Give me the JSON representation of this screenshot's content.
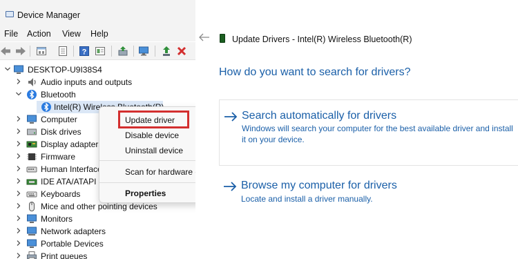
{
  "device_manager": {
    "title": "Device Manager",
    "menu": [
      "File",
      "Action",
      "View",
      "Help"
    ],
    "toolbar_icons": [
      "back-icon",
      "forward-icon",
      "properties-icon",
      "show-hidden-icon",
      "help-icon",
      "action-icon",
      "update-driver-icon",
      "monitor-icon",
      "enable-icon",
      "uninstall-icon"
    ],
    "root": "DESKTOP-U9I38S4",
    "tree": [
      {
        "label": "Audio inputs and outputs",
        "icon": "audio-icon"
      },
      {
        "label": "Bluetooth",
        "icon": "bluetooth-icon",
        "expanded": true
      },
      {
        "label": "Intel(R) Wireless Bluetooth(R)",
        "icon": "bluetooth-device-icon",
        "selected": true
      },
      {
        "label": "Computer",
        "icon": "computer-icon"
      },
      {
        "label": "Disk drives",
        "icon": "disk-drive-icon"
      },
      {
        "label": "Display adapters",
        "icon": "display-adapter-icon"
      },
      {
        "label": "Firmware",
        "icon": "firmware-icon"
      },
      {
        "label": "Human Interface Devices",
        "icon": "hid-icon"
      },
      {
        "label": "IDE ATA/ATAPI controllers",
        "icon": "ide-icon"
      },
      {
        "label": "Keyboards",
        "icon": "keyboard-icon"
      },
      {
        "label": "Mice and other pointing devices",
        "icon": "mouse-icon"
      },
      {
        "label": "Monitors",
        "icon": "monitor-icon"
      },
      {
        "label": "Network adapters",
        "icon": "network-adapter-icon"
      },
      {
        "label": "Portable Devices",
        "icon": "portable-device-icon"
      },
      {
        "label": "Print queues",
        "icon": "printer-icon"
      }
    ]
  },
  "context_menu": {
    "update_driver": "Update driver",
    "disable_device": "Disable device",
    "uninstall_device": "Uninstall device",
    "scan": "Scan for hardware changes",
    "properties": "Properties"
  },
  "update_drivers": {
    "title": "Update Drivers - Intel(R) Wireless Bluetooth(R)",
    "heading": "How do you want to search for drivers?",
    "option_auto": {
      "title": "Search automatically for drivers",
      "desc": "Windows will search your computer for the best available driver and install it on your device."
    },
    "option_browse": {
      "title": "Browse my computer for drivers",
      "desc": "Locate and install a driver manually."
    }
  },
  "colors": {
    "accent_blue": "#1a5fa8",
    "highlight_red": "#d32f2f",
    "selection": "#dbe7f6"
  }
}
